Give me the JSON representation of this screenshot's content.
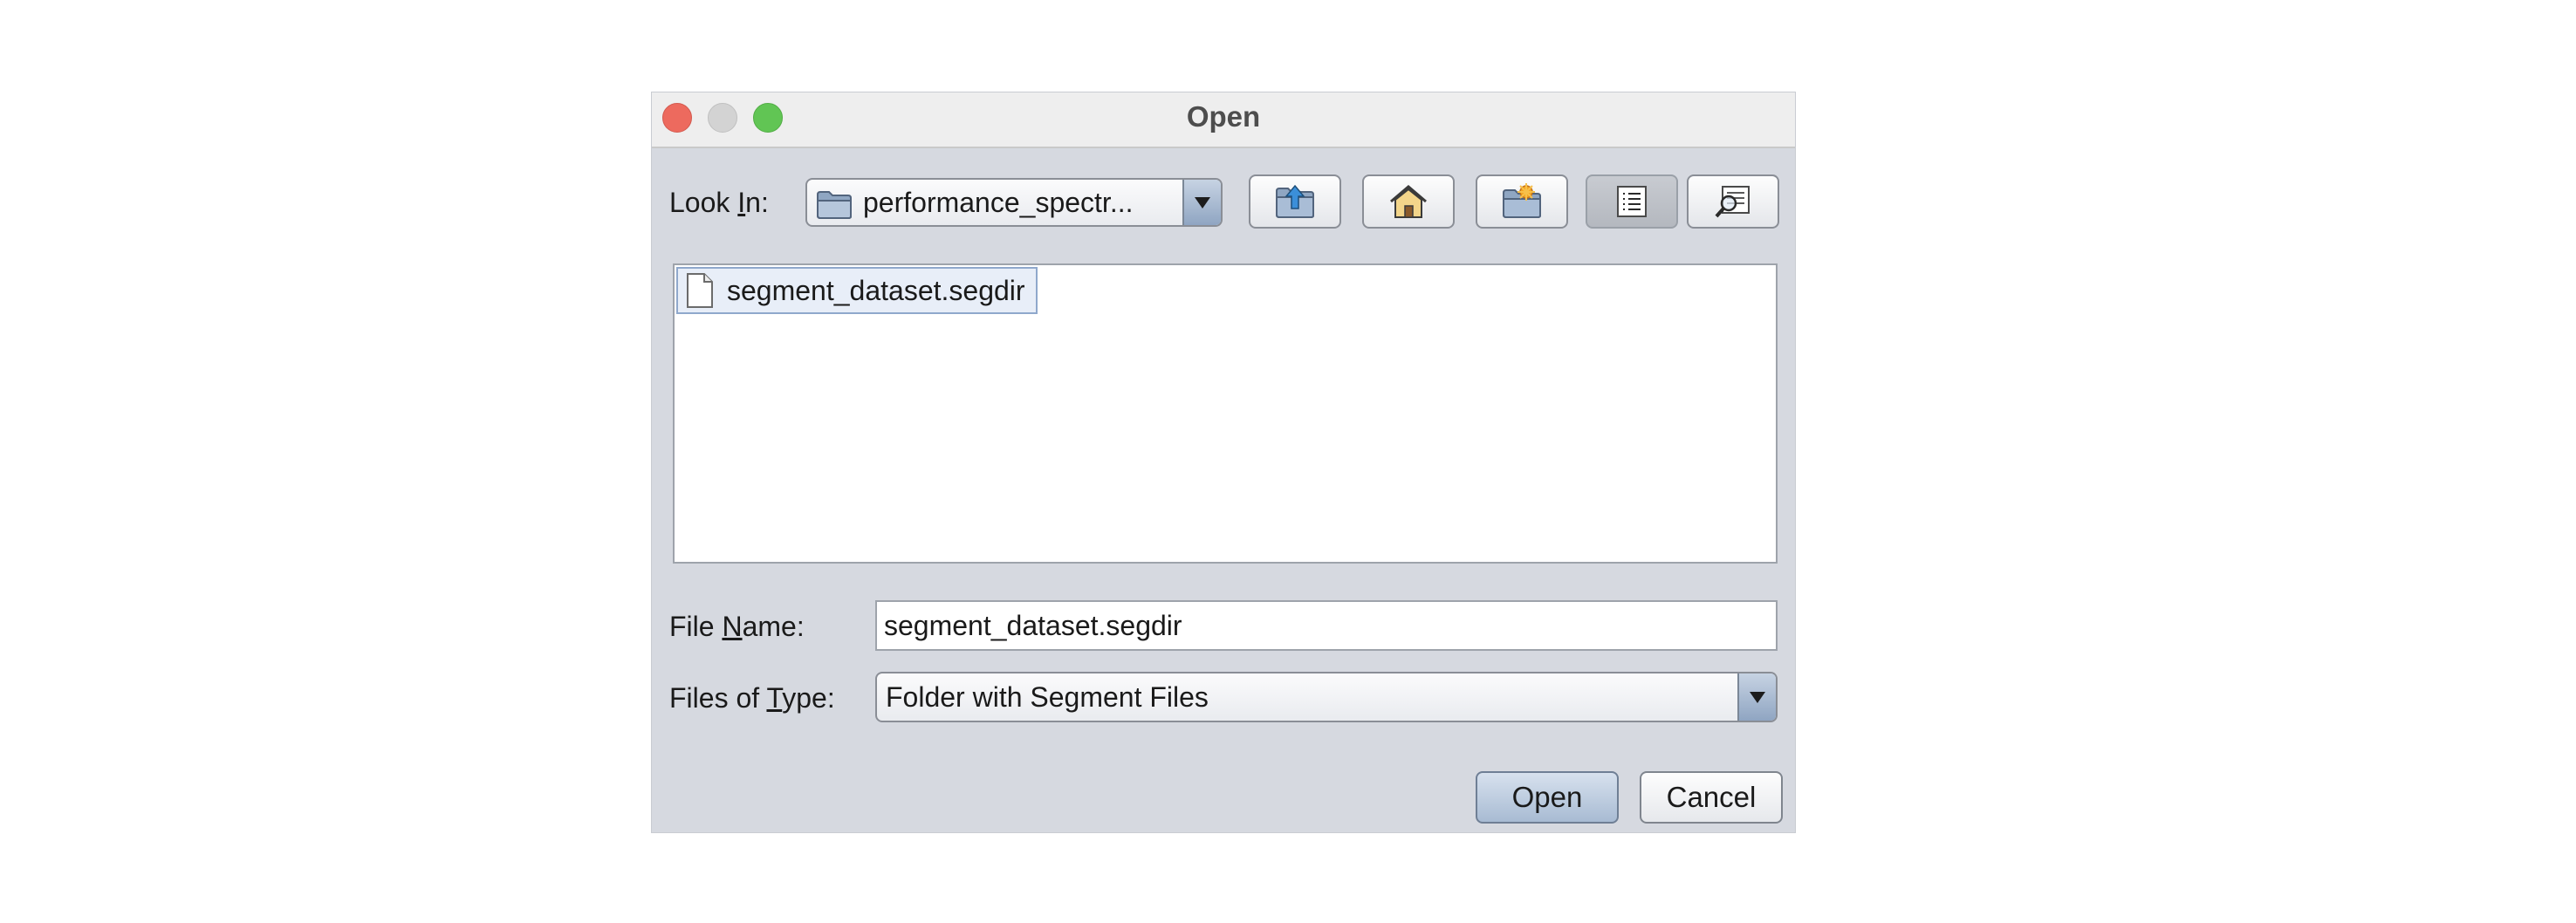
{
  "dialog": {
    "title": "Open",
    "look_in": {
      "label_pre": "Look ",
      "label_mnemonic": "I",
      "label_post": "n:",
      "value": "performance_spectr..."
    },
    "toolbar": [
      {
        "name": "up-one-level",
        "icon": "folder-up-icon"
      },
      {
        "name": "home",
        "icon": "home-icon"
      },
      {
        "name": "new-folder",
        "icon": "new-folder-icon"
      },
      {
        "name": "list-view",
        "icon": "list-view-icon",
        "active": true
      },
      {
        "name": "details-view",
        "icon": "details-view-icon"
      }
    ],
    "files": [
      {
        "name": "segment_dataset.segdir",
        "icon": "file-icon",
        "selected": true
      }
    ],
    "file_name": {
      "label_pre": "File ",
      "label_mnemonic": "N",
      "label_post": "ame:",
      "value": "segment_dataset.segdir"
    },
    "files_of_type": {
      "label_pre": "Files of ",
      "label_mnemonic": "T",
      "label_post": "ype:",
      "value": "Folder with Segment Files"
    },
    "buttons": {
      "open": "Open",
      "cancel": "Cancel"
    }
  }
}
